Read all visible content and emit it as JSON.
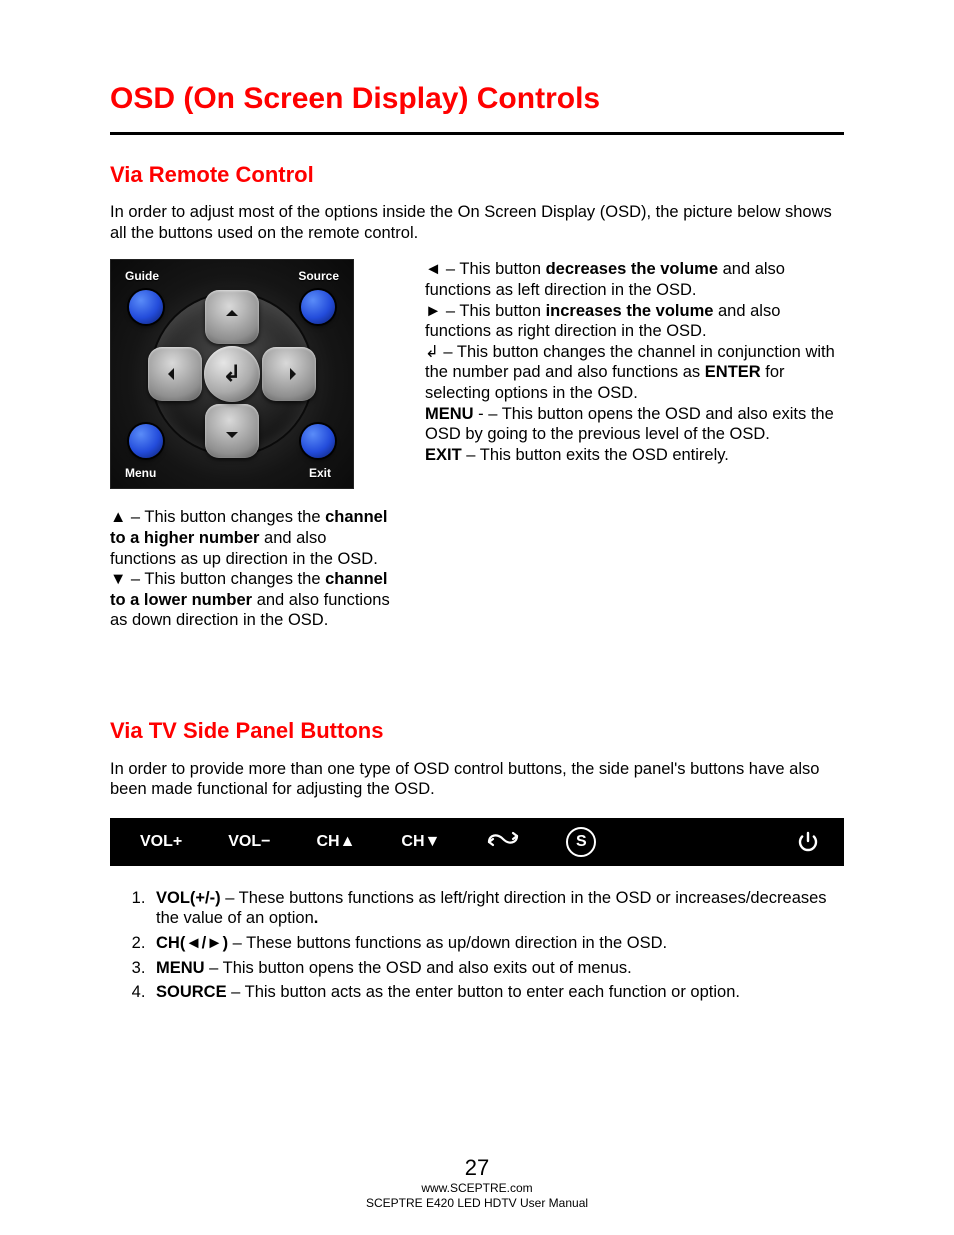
{
  "title": "OSD (On Screen Display) Controls",
  "section1": {
    "heading": "Via Remote Control",
    "intro": "In order to adjust most of the options inside the On Screen Display (OSD), the picture below shows all the buttons used on the remote control."
  },
  "remote": {
    "tl": "Guide",
    "tr": "Source",
    "bl": "Menu",
    "br": "Exit"
  },
  "left_desc": {
    "up_pre": "▲ – This button changes the ",
    "up_bold": "channel to a higher number",
    "up_post": " and also functions as up direction in the OSD.",
    "dn_pre": "▼ – This button changes the ",
    "dn_bold": "channel to a lower number",
    "dn_post": " and also functions as down direction in the OSD."
  },
  "right_desc": {
    "l_pre": "◄ – This button ",
    "l_bold": "decreases the volume",
    "l_post": " and also functions as left direction in the OSD.",
    "r_pre": "► – This button ",
    "r_bold": "increases the volume",
    "r_post": " and also functions as right direction in the OSD.",
    "ent_pre": "↲ – This button changes the channel in conjunction with the number pad and also functions as ",
    "ent_bold": "ENTER",
    "ent_post": " for selecting options in the OSD.",
    "menu_bold": "MENU",
    "menu_post": " - – This button opens the OSD and also exits the OSD by going to the previous level of the OSD.",
    "exit_bold": "EXIT",
    "exit_post": " – This button exits the OSD entirely."
  },
  "section2": {
    "heading": "Via TV Side Panel Buttons",
    "intro": "In order to provide more than one type of OSD control buttons, the side panel's buttons have also been made functional for adjusting the OSD."
  },
  "panel": {
    "vp": "VOL+",
    "vm": "VOL−",
    "cu": "CH▲",
    "cd": "CH▼",
    "s": "S"
  },
  "list": {
    "i1b": "VOL(+/-)",
    "i1t": " – These buttons functions as left/right direction in the OSD or increases/decreases the value of an option",
    "i2b": "CH(◄/►)",
    "i2t": " – These buttons functions as up/down direction in the OSD.",
    "i3b": "MENU",
    "i3t": " – This button opens the OSD and also exits out of menus.",
    "i4b": "SOURCE",
    "i4t": " – This button acts as the enter button to enter each function or option."
  },
  "footer": {
    "page": "27",
    "url": "www.SCEPTRE.com",
    "manual": "SCEPTRE E420 LED HDTV User Manual"
  }
}
